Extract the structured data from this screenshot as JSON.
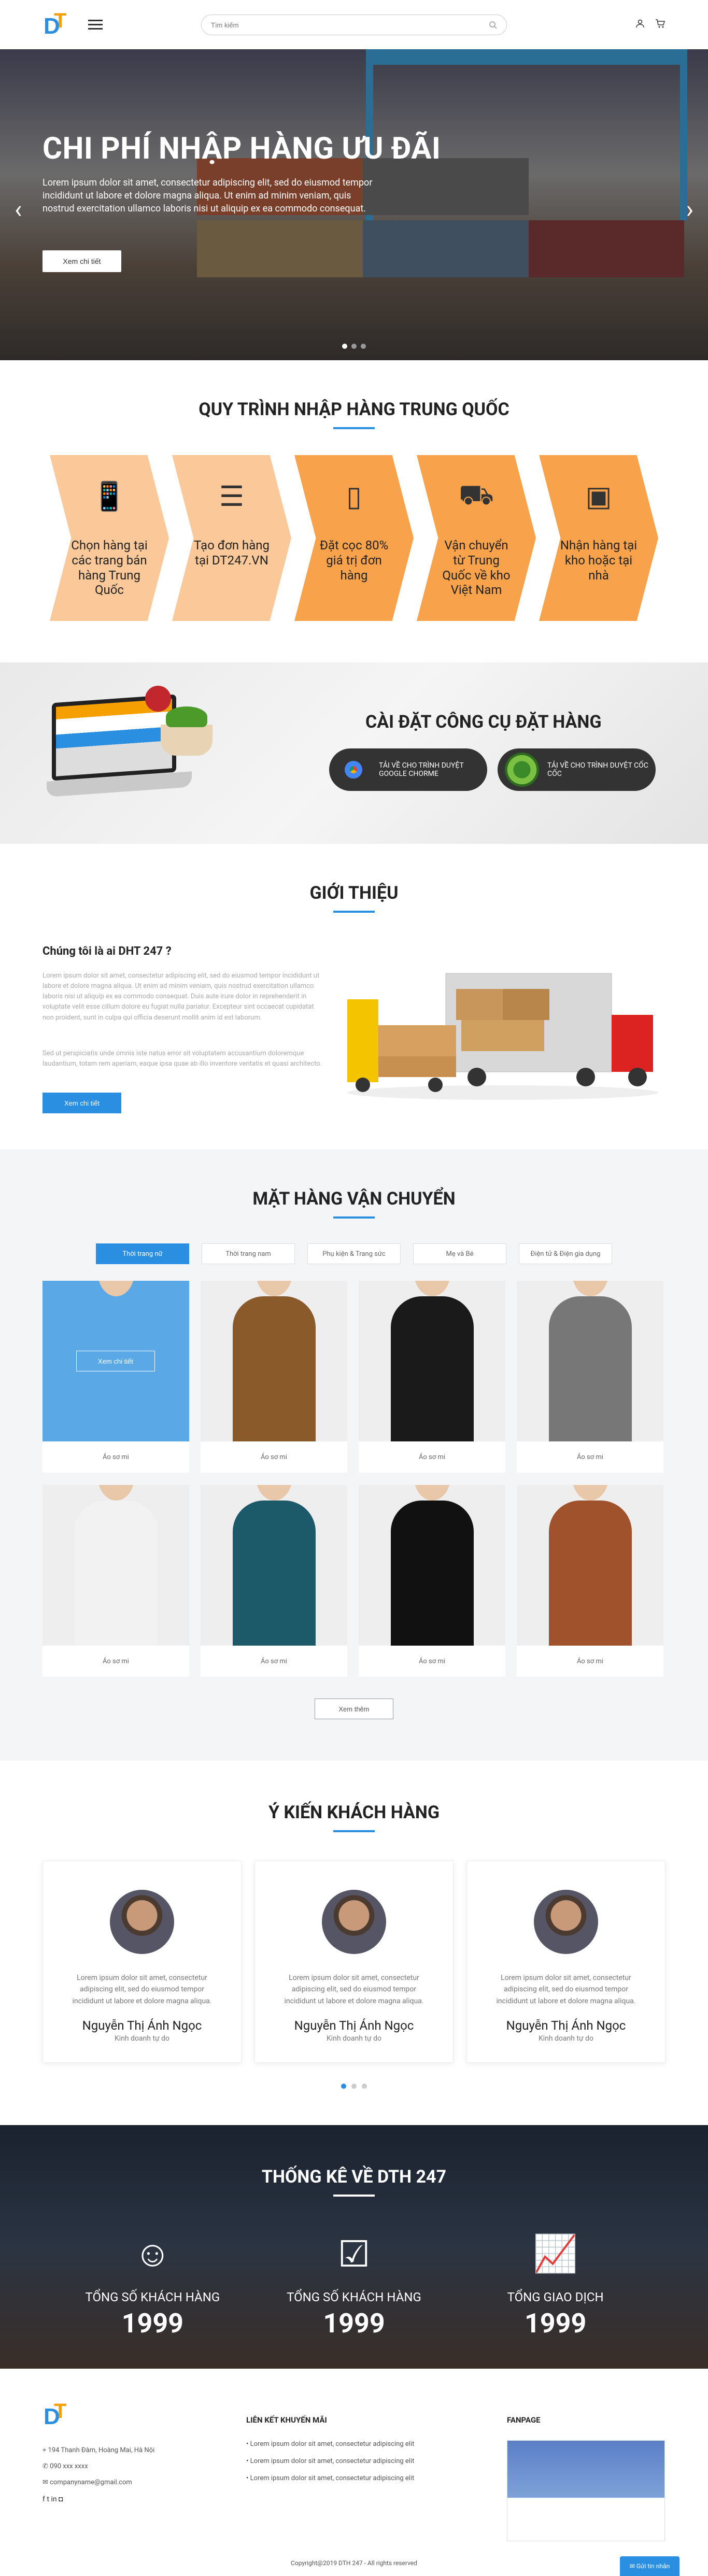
{
  "header": {
    "logo_letters": [
      "D",
      "T"
    ],
    "search_placeholder": "Tìm kiếm",
    "icons": [
      "menu-icon",
      "search-icon",
      "user-icon",
      "cart-icon"
    ]
  },
  "hero": {
    "title": "CHI PHÍ NHẬP HÀNG ƯU ĐÃI",
    "text": "Lorem ipsum dolor sit amet, consectetur adipiscing elit, sed do eiusmod tempor incididunt ut labore et dolore magna aliqua. Ut enim ad minim veniam, quis nostrud exercitation ullamco laboris nisi ut aliquip ex ea commodo consequat.",
    "button": "Xem chi tiết"
  },
  "process": {
    "title": "QUY TRÌNH NHẬP HÀNG TRUNG QUỐC",
    "steps": [
      {
        "label": "Chọn hàng tại các trang bán hàng Trung Quốc",
        "icon": "phone-shop-icon"
      },
      {
        "label": "Tạo đơn hàng tại DT247.VN",
        "icon": "list-icon"
      },
      {
        "label": "Đặt cọc 80% giá trị đơn hàng",
        "icon": "phone-pay-icon"
      },
      {
        "label": "Vận chuyển từ Trung Quốc về kho Việt Nam",
        "icon": "delivery-icon"
      },
      {
        "label": "Nhận hàng tại kho hoặc tại nhà",
        "icon": "box-hand-icon"
      }
    ]
  },
  "tool": {
    "title": "CÀI ĐẶT CÔNG CỤ ĐẶT HÀNG",
    "chrome": "TẢI VỀ CHO TRÌNH DUYỆT GOOGLE CHORME",
    "coccoc": "TẢI VỀ CHO TRÌNH DUYỆT CỐC CỐC"
  },
  "intro": {
    "title": "GIỚI THIỆU",
    "heading": "Chúng tôi là ai DHT 247 ?",
    "p1": "Lorem ipsum dolor sit amet, consectetur adipiscing elit, sed do eiusmod tempor incididunt ut labore et dolore magna aliqua. Ut enim ad minim veniam, quis nostrud exercitation ullamco laboris nisi ut aliquip ex ea commodo consequat. Duis aute irure dolor in reprehenderit in voluptate velit esse cillum dolore eu fugiat nulla pariatur. Excepteur sint occaecat cupidatat non proident, sunt in culpa qui officia deserunt mollit anim id est laborum.",
    "p2": "Sed ut perspiciatis unde omnis iste natus error sit voluptatem accusantium doloremque laudantium, totam rem aperiam, eaque ipsa quae ab illo inventore veritatis et quasi architecto.",
    "button": "Xem chi tiết"
  },
  "products": {
    "title": "MẶT HÀNG VẬN CHUYỂN",
    "tabs": [
      "Thời trang nữ",
      "Thời trang nam",
      "Phụ kiện & Trang sức",
      "Mẹ và Bé",
      "Điện tử & Điện gia dụng"
    ],
    "hover_button": "Xem chi tiết",
    "items": [
      "Áo sơ mi",
      "Áo sơ mi",
      "Áo sơ mi",
      "Áo sơ mi",
      "Áo sơ mi",
      "Áo sơ mi",
      "Áo sơ mi",
      "Áo sơ mi"
    ],
    "item_colors": [
      "#5aa9e6",
      "#8b5a2b",
      "#1a1a1a",
      "#777777",
      "#f2f2f2",
      "#1c5a6a",
      "#111111",
      "#a0522d"
    ],
    "more": "Xem thêm"
  },
  "testimonials": {
    "title": "Ý KIẾN KHÁCH HÀNG",
    "items": [
      {
        "text": "Lorem ipsum dolor sit amet, consectetur adipiscing elit, sed do eiusmod tempor incididunt ut labore et dolore magna aliqua.",
        "name": "Nguyễn Thị Ánh Ngọc",
        "role": "Kinh doanh tự do"
      },
      {
        "text": "Lorem ipsum dolor sit amet, consectetur adipiscing elit, sed do eiusmod tempor incididunt ut labore et dolore magna aliqua.",
        "name": "Nguyễn Thị Ánh Ngọc",
        "role": "Kinh doanh tự do"
      },
      {
        "text": "Lorem ipsum dolor sit amet, consectetur adipiscing elit, sed do eiusmod tempor incididunt ut labore et dolore magna aliqua.",
        "name": "Nguyễn Thị Ánh Ngọc",
        "role": "Kinh doanh tự do"
      }
    ]
  },
  "stats": {
    "title": "THỐNG KÊ VỀ DTH 247",
    "items": [
      {
        "label": "TỔNG SỐ KHÁCH HÀNG",
        "value": "1999"
      },
      {
        "label": "TỔNG SỐ KHÁCH HÀNG",
        "value": "1999"
      },
      {
        "label": "TỔNG GIAO DỊCH",
        "value": "1999"
      }
    ]
  },
  "footer": {
    "address": "194 Thanh Đàm, Hoàng Mai, Hà Nội",
    "phone": "090 xxx xxxx",
    "email": "companyname@gmail.com",
    "links_title": "LIÊN KẾT KHUYẾN MÃI",
    "links": [
      "Lorem ipsum dolor sit amet, consectetur adipiscing elit",
      "Lorem ipsum dolor sit amet, consectetur adipiscing elit",
      "Lorem ipsum dolor sit amet, consectetur adipiscing elit"
    ],
    "fanpage_title": "FANPAGE",
    "copyright": "Copyright@2019 DTH 247 - All rights reserved",
    "chat": "Gửi tin nhắn"
  }
}
